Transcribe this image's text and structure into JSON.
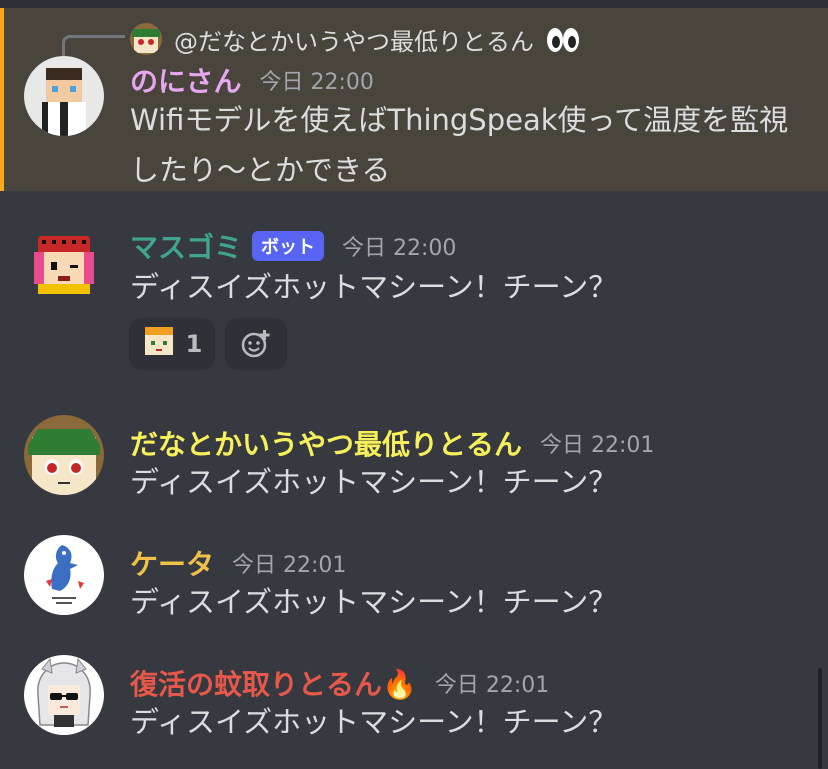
{
  "reply": {
    "mention": "@だなとかいうやつ最低りとるん",
    "emoji": "eyes-emoji"
  },
  "messages": [
    {
      "author": "のにさん",
      "author_color": "#e7a7f0",
      "timestamp": "今日 22:00",
      "text": "Wifiモデルを使えばThingSpeak使って温度を監視したり〜とかできる",
      "avatar_icon": "pixel-boy-avatar-icon"
    },
    {
      "author": "マスゴミ",
      "author_color": "#3fa58c",
      "badge": "ボット",
      "timestamp": "今日 22:00",
      "text": "ディスイズホットマシーン！チーン？",
      "avatar_icon": "pixel-girl-avatar-icon",
      "reactions": [
        {
          "emoji": "custom-face-emoji",
          "count": "1"
        }
      ]
    },
    {
      "author": "だなとかいうやつ最低りとるん",
      "author_color": "#f7f05a",
      "timestamp": "今日 22:01",
      "text": "ディスイズホットマシーン！チーン？",
      "avatar_icon": "green-hair-avatar-icon"
    },
    {
      "author": "ケータ",
      "author_color": "#f0c04a",
      "timestamp": "今日 22:01",
      "text": "ディスイズホットマシーン！チーン？",
      "avatar_icon": "bird-avatar-icon"
    },
    {
      "author": "復活の蚊取りとるん🔥",
      "author_color": "#e8584a",
      "timestamp": "今日 22:01",
      "text": "ディスイズホットマシーン！チーン？",
      "avatar_icon": "anime-girl-avatar-icon"
    }
  ]
}
